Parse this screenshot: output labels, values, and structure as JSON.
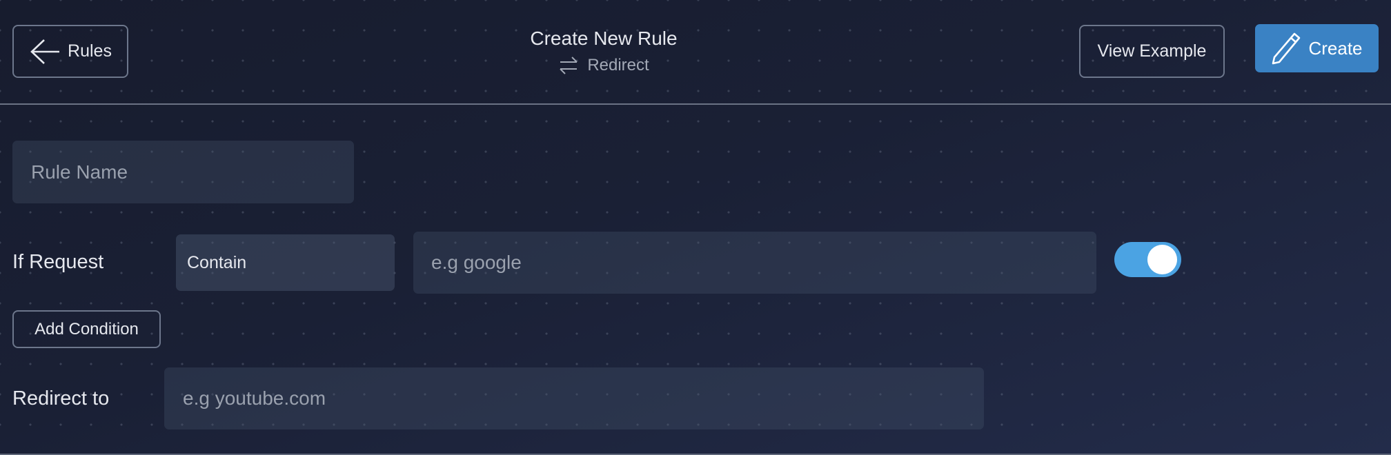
{
  "header": {
    "back_label": "Rules",
    "title": "Create New Rule",
    "subtitle": "Redirect",
    "view_example_label": "View Example",
    "create_label": "Create"
  },
  "form": {
    "rule_name_placeholder": "Rule Name",
    "if_request_label": "If Request",
    "condition_operator": "Contain",
    "condition_placeholder": "e.g google",
    "condition_enabled": true,
    "add_condition_label": "Add Condition",
    "redirect_label": "Redirect to",
    "redirect_placeholder": "e.g youtube.com"
  },
  "colors": {
    "accent": "#3a82c4",
    "toggle": "#4ba3e3",
    "background": "#1a2035"
  }
}
